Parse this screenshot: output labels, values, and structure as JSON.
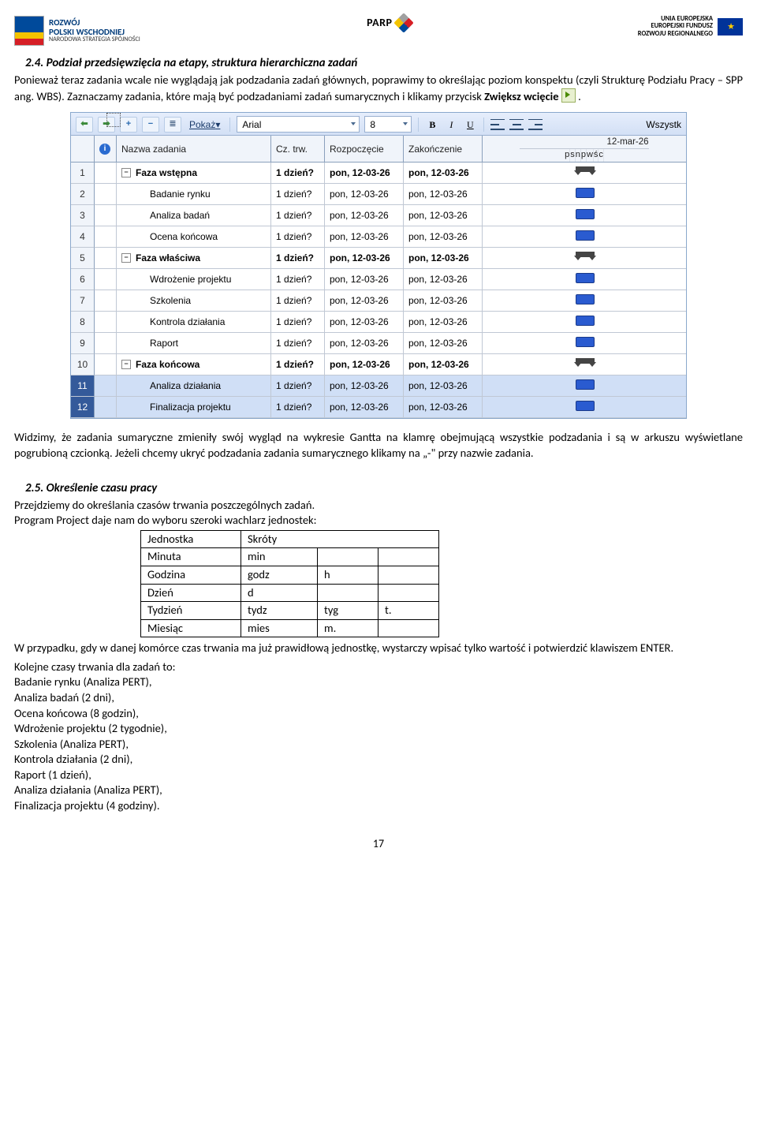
{
  "header": {
    "left_title_1": "ROZWÓJ",
    "left_title_2": "POLSKI WSCHODNIEJ",
    "left_sub": "NARODOWA STRATEGIA SPÓJNOŚCI",
    "center": "PARP",
    "right_1": "UNIA EUROPEJSKA",
    "right_2": "EUROPEJSKI FUNDUSZ",
    "right_3": "ROZWOJU REGIONALNEGO"
  },
  "s24": {
    "title": "2.4. Podział przedsięwzięcia na etapy, struktura hierarchiczna zadań",
    "p1a": "Ponieważ teraz zadania wcale nie wyglądają jak podzadania zadań głównych, poprawimy to określając poziom konspektu (czyli Strukturę Podziału Pracy – SPP ang. WBS). Zaznaczamy zadania, które mają być podzadaniami zadań sumarycznych i klikamy przycisk ",
    "p1b": "Zwiększ wcięcie",
    "p1c": " ",
    "p1d": "."
  },
  "toolbar": {
    "pokaz": "Pokaż",
    "font": "Arial",
    "size": "8",
    "wszystk": "Wszystk"
  },
  "gridhdr": {
    "nazwa": "Nazwa zadania",
    "cz": "Cz. trw.",
    "rozp": "Rozpoczęcie",
    "zak": "Zakończenie",
    "date": "12-mar-26",
    "days": [
      "p",
      "s",
      "n",
      "p",
      "w",
      "ś",
      "c"
    ]
  },
  "rows": [
    {
      "n": "1",
      "name": "Faza wstępna",
      "sum": true,
      "dur": "1 dzień?",
      "s": "pon, 12-03-26",
      "e": "pon, 12-03-26"
    },
    {
      "n": "2",
      "name": "Badanie rynku",
      "sum": false,
      "dur": "1 dzień?",
      "s": "pon, 12-03-26",
      "e": "pon, 12-03-26"
    },
    {
      "n": "3",
      "name": "Analiza badań",
      "sum": false,
      "dur": "1 dzień?",
      "s": "pon, 12-03-26",
      "e": "pon, 12-03-26"
    },
    {
      "n": "4",
      "name": "Ocena końcowa",
      "sum": false,
      "dur": "1 dzień?",
      "s": "pon, 12-03-26",
      "e": "pon, 12-03-26"
    },
    {
      "n": "5",
      "name": "Faza właściwa",
      "sum": true,
      "dur": "1 dzień?",
      "s": "pon, 12-03-26",
      "e": "pon, 12-03-26"
    },
    {
      "n": "6",
      "name": "Wdrożenie projektu",
      "sum": false,
      "dur": "1 dzień?",
      "s": "pon, 12-03-26",
      "e": "pon, 12-03-26"
    },
    {
      "n": "7",
      "name": "Szkolenia",
      "sum": false,
      "dur": "1 dzień?",
      "s": "pon, 12-03-26",
      "e": "pon, 12-03-26"
    },
    {
      "n": "8",
      "name": "Kontrola działania",
      "sum": false,
      "dur": "1 dzień?",
      "s": "pon, 12-03-26",
      "e": "pon, 12-03-26"
    },
    {
      "n": "9",
      "name": "Raport",
      "sum": false,
      "dur": "1 dzień?",
      "s": "pon, 12-03-26",
      "e": "pon, 12-03-26"
    },
    {
      "n": "10",
      "name": "Faza końcowa",
      "sum": true,
      "dur": "1 dzień?",
      "s": "pon, 12-03-26",
      "e": "pon, 12-03-26"
    },
    {
      "n": "11",
      "name": "Analiza działania",
      "sum": false,
      "dur": "1 dzień?",
      "s": "pon, 12-03-26",
      "e": "pon, 12-03-26",
      "sel": true
    },
    {
      "n": "12",
      "name": "Finalizacja projektu",
      "sum": false,
      "dur": "1 dzień?",
      "s": "pon, 12-03-26",
      "e": "pon, 12-03-26",
      "sel": true
    }
  ],
  "after_grid": "Widzimy, że zadania sumaryczne zmieniły swój wygląd na wykresie Gantta na klamrę obejmującą wszystkie podzadania i są w arkuszu wyświetlane pogrubioną czcionką. Jeżeli chcemy ukryć podzadania zadania sumarycznego klikamy na „-\" przy nazwie zadania.",
  "s25": {
    "title": "2.5. Określenie czasu pracy",
    "p1": "Przejdziemy do określania czasów trwania poszczególnych zadań.",
    "p2": "Program Project daje nam do wyboru szeroki wachlarz jednostek:",
    "thead": {
      "u": "Jednostka",
      "s": "Skróty"
    },
    "units": [
      {
        "u": "Minuta",
        "a": "min",
        "b": "",
        "c": ""
      },
      {
        "u": "Godzina",
        "a": "godz",
        "b": "h",
        "c": ""
      },
      {
        "u": "Dzień",
        "a": "d",
        "b": "",
        "c": ""
      },
      {
        "u": "Tydzień",
        "a": "tydz",
        "b": "tyg",
        "c": "t."
      },
      {
        "u": "Miesiąc",
        "a": "mies",
        "b": "m.",
        "c": ""
      }
    ],
    "p3": "W przypadku, gdy w danej komórce czas trwania ma już prawidłową jednostkę, wystarczy wpisać tylko wartość i potwierdzić klawiszem ENTER.",
    "p4": "Kolejne czasy trwania dla zadań to:",
    "lines": [
      "Badanie rynku (Analiza PERT),",
      "Analiza badań (2 dni),",
      "Ocena końcowa (8 godzin),",
      "Wdrożenie projektu (2 tygodnie),",
      "Szkolenia (Analiza PERT),",
      "Kontrola działania (2 dni),",
      "Raport (1 dzień),",
      "Analiza działania (Analiza PERT),",
      "Finalizacja projektu (4 godziny)."
    ]
  },
  "pagenum": "17"
}
